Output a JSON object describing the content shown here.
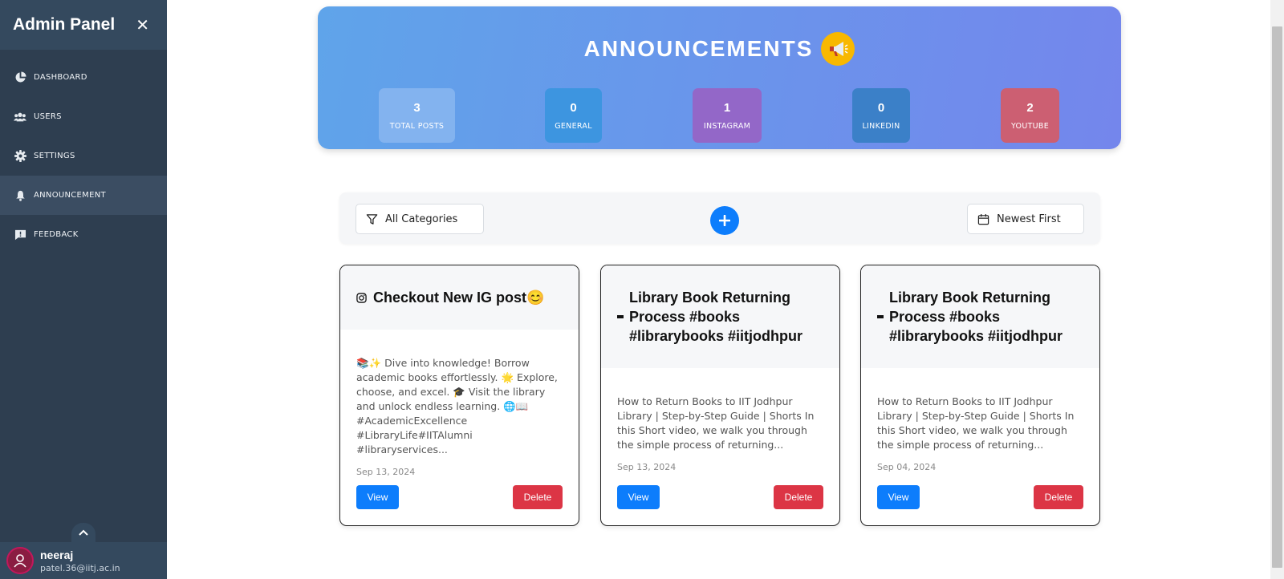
{
  "sidebar": {
    "title": "Admin Panel",
    "items": [
      {
        "label": "DASHBOARD",
        "icon": "pie-chart-icon"
      },
      {
        "label": "USERS",
        "icon": "users-icon"
      },
      {
        "label": "SETTINGS",
        "icon": "gear-icon"
      },
      {
        "label": "ANNOUNCEMENT",
        "icon": "bell-icon",
        "active": true
      },
      {
        "label": "FEEDBACK",
        "icon": "feedback-icon"
      }
    ],
    "user": {
      "name": "neeraj",
      "email": "patel.36@iitj.ac.in"
    }
  },
  "hero": {
    "title": "ANNOUNCEMENTS",
    "stats": [
      {
        "count": "3",
        "label": "TOTAL POSTS",
        "color": "#83b3ef"
      },
      {
        "count": "0",
        "label": "GENERAL",
        "color": "#3d95e0"
      },
      {
        "count": "1",
        "label": "INSTAGRAM",
        "color": "#9367c8"
      },
      {
        "count": "0",
        "label": "LINKEDIN",
        "color": "#3b80c8"
      },
      {
        "count": "2",
        "label": "YOUTUBE",
        "color": "#cc5f72"
      }
    ]
  },
  "toolbar": {
    "filter_label": "All Categories",
    "sort_label": "Newest First"
  },
  "posts": [
    {
      "title": "Checkout New IG post😊",
      "icon": "instagram-icon",
      "description": "📚✨ Dive into knowledge! Borrow academic books effortlessly. 🌟 Explore, choose, and excel. 🎓 Visit the library and unlock endless learning. 🌐📖 #AcademicExcellence #LibraryLife#IITAlumni #libraryservices...",
      "date": "Sep 13, 2024",
      "view_label": "View",
      "delete_label": "Delete"
    },
    {
      "title": "Library Book Returning Process #books #librarybooks #iitjodhpur",
      "icon": "youtube-icon",
      "description": "How to Return Books to IIT Jodhpur Library | Step-by-Step Guide | Shorts In this Short video, we walk you through the simple process of returning...",
      "date": "Sep 13, 2024",
      "view_label": "View",
      "delete_label": "Delete"
    },
    {
      "title": "Library Book Returning Process #books #librarybooks #iitjodhpur",
      "icon": "youtube-icon",
      "description": "How to Return Books to IIT Jodhpur Library | Step-by-Step Guide | Shorts In this Short video, we walk you through the simple process of returning...",
      "date": "Sep 04, 2024",
      "view_label": "View",
      "delete_label": "Delete"
    }
  ]
}
